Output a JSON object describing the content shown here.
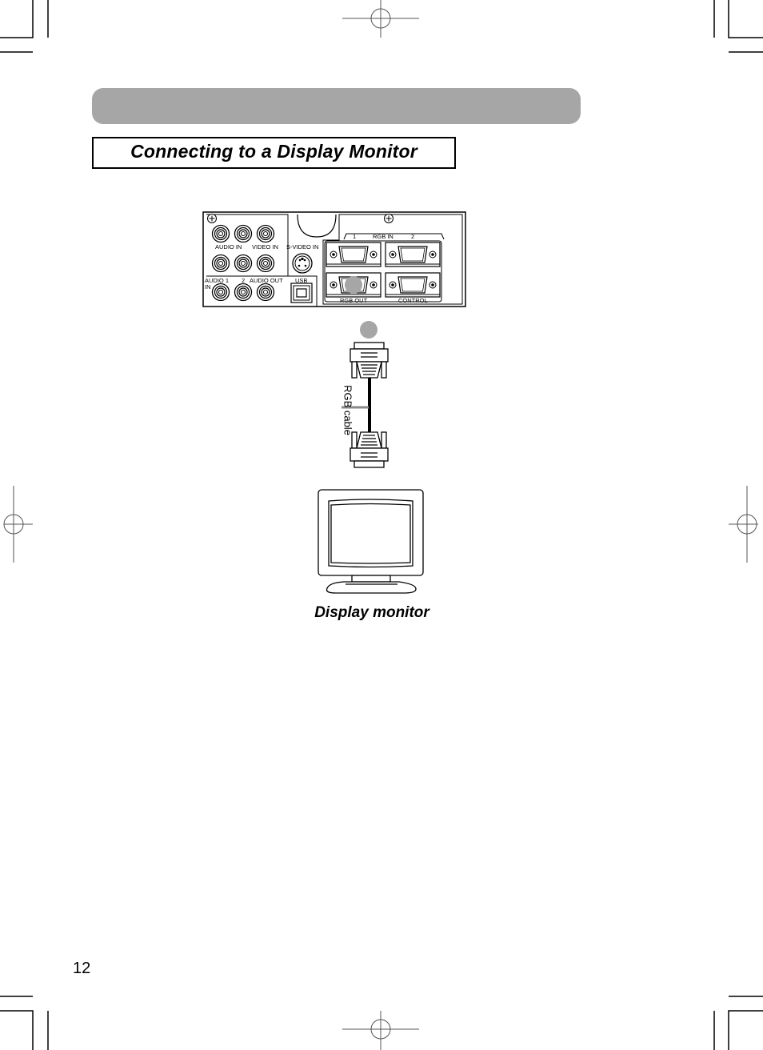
{
  "header": {
    "bar_color": "#a6a6a6",
    "title": "Connecting to a Display Monitor"
  },
  "panel": {
    "labels": {
      "audio_in": "AUDIO IN",
      "video_in": "VIDEO IN",
      "s_video_in": "S-VIDEO IN",
      "rgb_in_1": "1",
      "rgb_in": "RGB  IN",
      "rgb_in_2": "2",
      "audio_1": "AUDIO 1",
      "in": "IN",
      "audio_2": "2",
      "audio_out": "AUDIO OUT",
      "usb": "USB",
      "rgb_out": "RGB  OUT",
      "control": "CONTROL"
    },
    "highlighted_port": "RGB OUT",
    "highlight_color": "#a6a6a6"
  },
  "cable": {
    "label": "RGB cable"
  },
  "monitor": {
    "caption": "Display monitor"
  },
  "page": {
    "number": "12"
  }
}
